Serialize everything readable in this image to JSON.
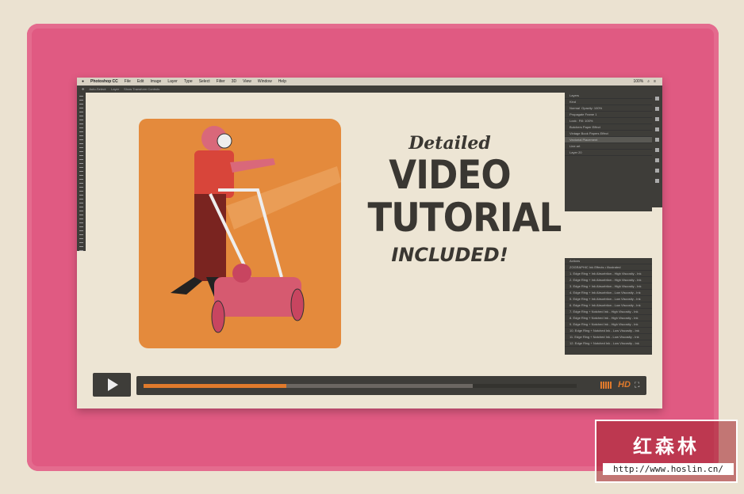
{
  "menubar": {
    "app": "Photoshop CC",
    "items": [
      "File",
      "Edit",
      "Image",
      "Layer",
      "Type",
      "Select",
      "Filter",
      "3D",
      "View",
      "Window",
      "Help"
    ],
    "zoom": "100%"
  },
  "optbar": {
    "auto_select": "Auto-Select:",
    "layer": "Layer",
    "transform": "Show Transform Controls"
  },
  "layers_panel": {
    "title": "Layers",
    "kind": "Kind",
    "mode": "Normal",
    "opacity_label": "Opacity:",
    "opacity": "100%",
    "lock_label": "Lock:",
    "fill_label": "Fill:",
    "fill": "100%",
    "propagate": "Propagate Frame 1",
    "layers": [
      "Butchers Paper Effect",
      "Vintage Book Papers Effect",
      "Vectorial Placement",
      "Line art",
      "Layer 20"
    ]
  },
  "actions_panel": {
    "title": "Actions",
    "set": "ZOGRAPHIC Ink Effects • Illustrated",
    "items": [
      "1. Edge Ring + Ink Absorbtion - High Viscosity - Ink",
      "2. Edge Ring + Ink Absorbtion - High Viscosity - Ink",
      "3. Edge Ring + Ink Absorbtion - High Viscosity - Ink",
      "4. Edge Ring + Ink Absorbtion - Low Viscosity - Ink",
      "5. Edge Ring + Ink Absorbtion - Low Viscosity - Ink",
      "6. Edge Ring + Ink Absorbtion - Low Viscosity - Ink",
      "7. Edge Ring + Notched Ink - High Viscosity - Ink",
      "8. Edge Ring + Notched Ink - High Viscosity - Ink",
      "9. Edge Ring + Notched Ink - High Viscosity - Ink",
      "10. Edge Ring + Notched Ink - Low Viscosity - Ink",
      "11. Edge Ring + Notched Ink - Low Viscosity - Ink",
      "12. Edge Ring + Notched Ink - Low Viscosity - Ink"
    ]
  },
  "headline": {
    "pre": "Detailed",
    "line1": "VIDEO",
    "line2": "TUTORIAL",
    "post": "INCLUDED!"
  },
  "player": {
    "progress_percent": 33,
    "buffered_percent": 76,
    "hd_label": "HD"
  },
  "watermark": {
    "name": "红森林",
    "url": "http://www.hoslin.cn/"
  },
  "colors": {
    "accent": "#e07a2c",
    "frame": "#e05a82",
    "panel": "#3e3d39"
  }
}
